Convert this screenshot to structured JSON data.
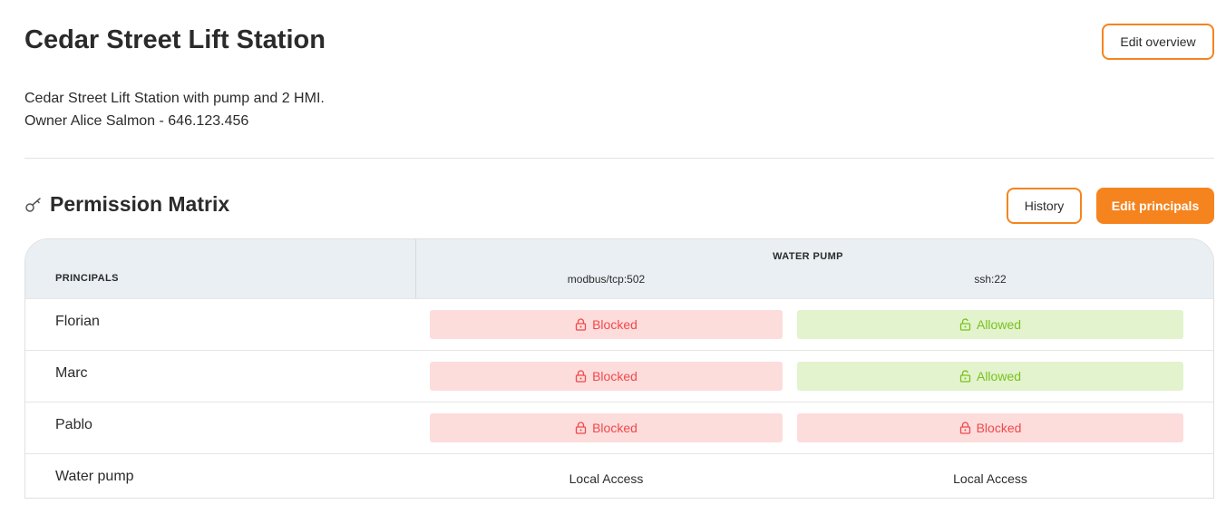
{
  "header": {
    "title": "Cedar Street Lift Station",
    "edit_overview_label": "Edit overview",
    "description_line1": "Cedar Street Lift Station with pump and 2 HMI.",
    "description_line2": "Owner Alice Salmon - 646.123.456"
  },
  "permission_matrix": {
    "title": "Permission Matrix",
    "icon": "key-icon",
    "history_label": "History",
    "edit_principals_label": "Edit principals",
    "columns": {
      "principals_header": "PRINCIPALS",
      "device": "WATER PUMP",
      "ports": [
        "modbus/tcp:502",
        "ssh:22"
      ]
    },
    "rows": [
      {
        "name": "Florian",
        "cells": [
          "Blocked",
          "Allowed"
        ]
      },
      {
        "name": "Marc",
        "cells": [
          "Blocked",
          "Allowed"
        ]
      },
      {
        "name": "Pablo",
        "cells": [
          "Blocked",
          "Blocked"
        ]
      },
      {
        "name": "Water pump",
        "cells": [
          "Local Access",
          "Local Access"
        ]
      }
    ]
  },
  "colors": {
    "accent": "#f5841f",
    "blocked_bg": "#fddcdc",
    "blocked_text": "#ef4a4a",
    "allowed_bg": "#e2f3cd",
    "allowed_text": "#7bc11d",
    "header_bg": "#e9eff3"
  }
}
